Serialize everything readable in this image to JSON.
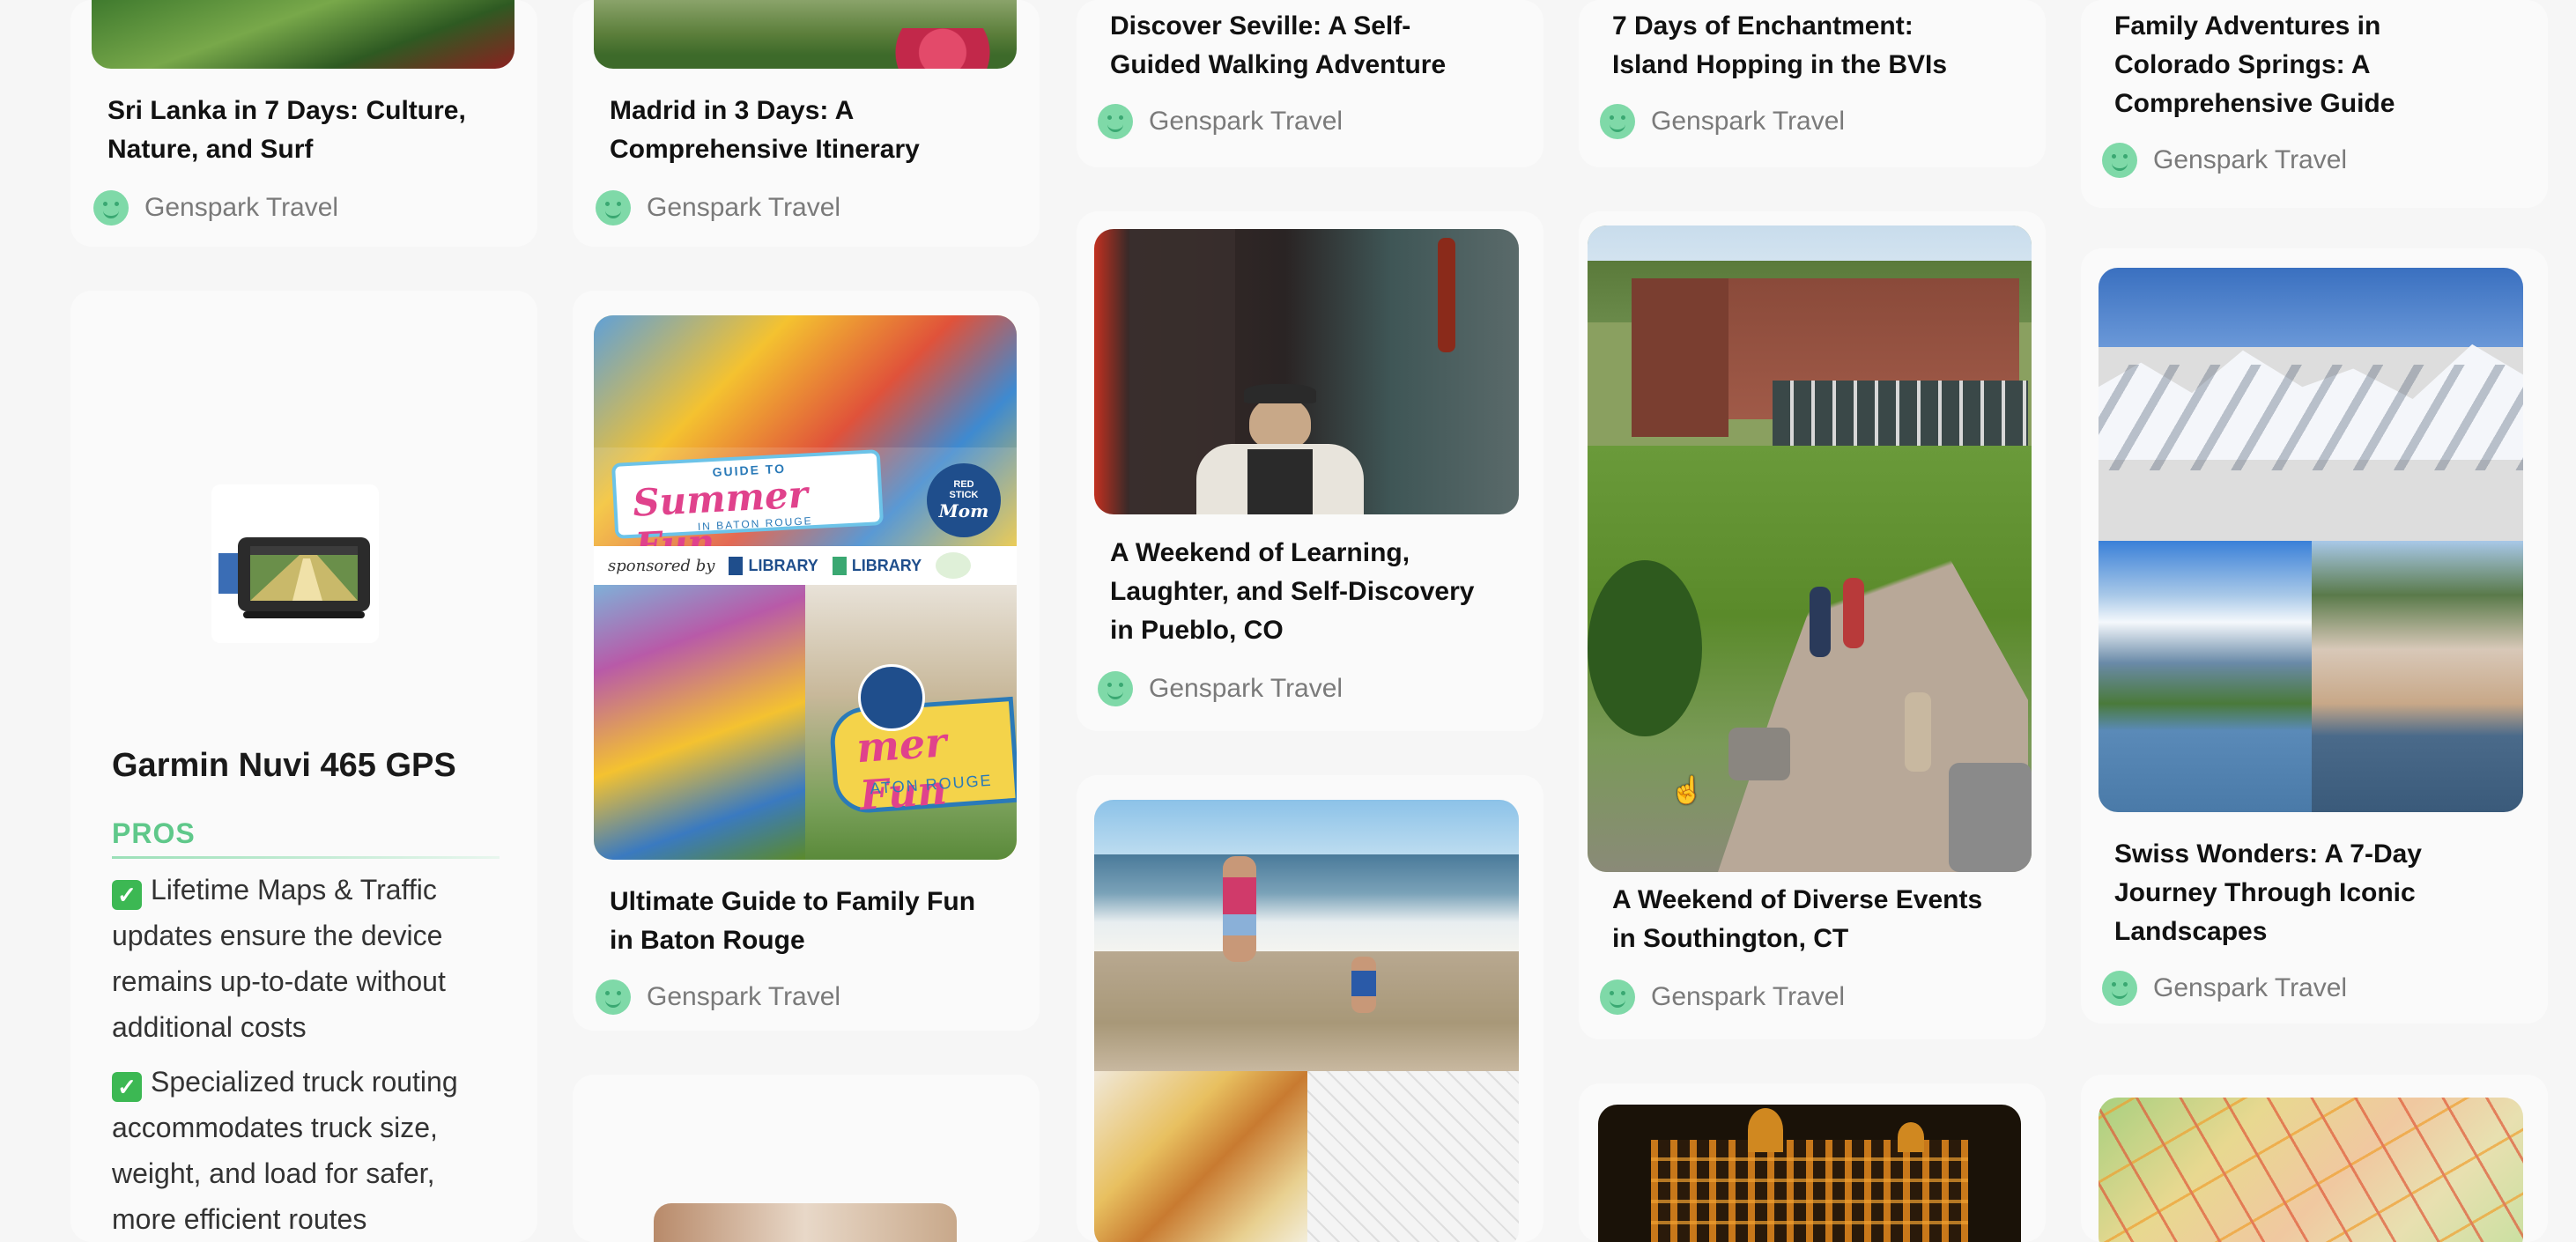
{
  "cards": [
    {
      "title_lines": [
        "Sri Lanka in 7 Days: Culture,",
        "Nature, and Surf"
      ],
      "author": "Genspark Travel"
    },
    {
      "title_lines": [
        "Madrid in 3 Days: A",
        "Comprehensive Itinerary"
      ],
      "author": "Genspark Travel"
    },
    {
      "title_lines": [
        "Discover Seville: A Self-",
        "Guided Walking Adventure"
      ],
      "author": "Genspark Travel"
    },
    {
      "title_lines": [
        "7 Days of Enchantment:",
        "Island Hopping in the BVIs"
      ],
      "author": "Genspark Travel"
    },
    {
      "title_lines": [
        "Family Adventures in",
        "Colorado Springs: A",
        "Comprehensive Guide"
      ],
      "author": "Genspark Travel"
    },
    {
      "title_lines": [
        "Ultimate Guide to Family Fun",
        "in Baton Rouge"
      ],
      "author": "Genspark Travel"
    },
    {
      "title_lines": [
        "A Weekend of Learning,",
        "Laughter, and Self-Discovery",
        "in Pueblo, CO"
      ],
      "author": "Genspark Travel"
    },
    {
      "title_lines": [
        "A Weekend of Diverse Events",
        "in Southington, CT"
      ],
      "author": "Genspark Travel"
    },
    {
      "title_lines": [
        "Swiss Wonders: A 7-Day",
        "Journey Through Iconic",
        "Landscapes"
      ],
      "author": "Genspark Travel"
    }
  ],
  "baton_rouge_image": {
    "guide_to": "GUIDE TO",
    "summer_fun": "Summer Fun",
    "in_baton_rouge": "IN BATON ROUGE",
    "sponsored_by": "sponsored by",
    "library": "LIBRARY",
    "badge_red": "RED",
    "badge_stick": "STICK",
    "badge_mom": "Mom",
    "fun_partial": "mer Fun",
    "aton_rouge_partial": "ATON ROUGE"
  },
  "product": {
    "name": "Garmin Nuvi 465 GPS",
    "pros_label": "PROS",
    "pros": [
      [
        "Lifetime Maps & Traffic",
        "updates ensure the device",
        "remains up-to-date without",
        "additional costs"
      ],
      [
        "Specialized truck routing",
        "accommodates truck size,",
        "weight, and load for safer,",
        "more efficient routes"
      ]
    ],
    "check_icon": "✓"
  },
  "colors": {
    "accent": "#5fc88a",
    "avatar": "#7fd9a8",
    "check": "#3cb853"
  }
}
